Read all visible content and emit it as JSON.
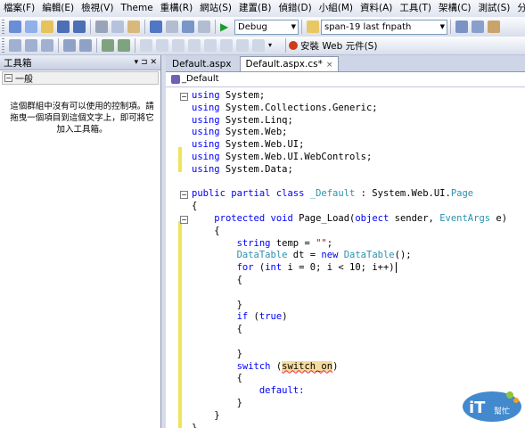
{
  "menu": [
    "檔案(F)",
    "編輯(E)",
    "檢視(V)",
    "Theme",
    "重構(R)",
    "網站(S)",
    "建置(B)",
    "偵錯(D)",
    "小組(M)",
    "資料(A)",
    "工具(T)",
    "架構(C)",
    "測試(S)",
    "分析(N)"
  ],
  "toolbar": {
    "config_combo": "Debug",
    "search_combo": "span-19 last fnpath",
    "install_web": "安裝 Web 元件(S)"
  },
  "toolbox": {
    "title": "工具箱",
    "pin": "▾ ⊐ ✕",
    "group": "一般",
    "group_toggle": "−",
    "empty_message": "這個群組中沒有可以使用的控制項。請拖曳一個項目到這個文字上，即可將它加入工具箱。"
  },
  "tabs": [
    "Default.aspx",
    "Default.aspx.cs*"
  ],
  "tab_close": "×",
  "breadcrumb": "_Default",
  "code_lines": [
    [
      {
        "t": "using",
        "c": "kw"
      },
      {
        "t": " System;"
      }
    ],
    [
      {
        "t": "using",
        "c": "kw"
      },
      {
        "t": " System.Collections.Generic;"
      }
    ],
    [
      {
        "t": "using",
        "c": "kw"
      },
      {
        "t": " System.Linq;"
      }
    ],
    [
      {
        "t": "using",
        "c": "kw"
      },
      {
        "t": " System.Web;"
      }
    ],
    [
      {
        "t": "using",
        "c": "kw"
      },
      {
        "t": " System.Web.UI;"
      }
    ],
    [
      {
        "t": "using",
        "c": "kw"
      },
      {
        "t": " System.Web.UI.WebControls;"
      }
    ],
    [
      {
        "t": "using",
        "c": "kw"
      },
      {
        "t": " System.Data;"
      }
    ],
    [
      {
        "t": ""
      }
    ],
    [
      {
        "t": "public partial class",
        "c": "kw"
      },
      {
        "t": " "
      },
      {
        "t": "_Default",
        "c": "ty"
      },
      {
        "t": " : System.Web.UI."
      },
      {
        "t": "Page",
        "c": "ty"
      }
    ],
    [
      {
        "t": "{"
      }
    ],
    [
      {
        "t": "    "
      },
      {
        "t": "protected void",
        "c": "kw"
      },
      {
        "t": " Page_Load("
      },
      {
        "t": "object",
        "c": "kw"
      },
      {
        "t": " sender, "
      },
      {
        "t": "EventArgs",
        "c": "ty"
      },
      {
        "t": " e)"
      }
    ],
    [
      {
        "t": "    {"
      }
    ],
    [
      {
        "t": "        "
      },
      {
        "t": "string",
        "c": "kw"
      },
      {
        "t": " temp = "
      },
      {
        "t": "\"\"",
        "c": "str"
      },
      {
        "t": ";"
      }
    ],
    [
      {
        "t": "        "
      },
      {
        "t": "DataTable",
        "c": "ty"
      },
      {
        "t": " dt = "
      },
      {
        "t": "new",
        "c": "kw"
      },
      {
        "t": " "
      },
      {
        "t": "DataTable",
        "c": "ty"
      },
      {
        "t": "();"
      }
    ],
    [
      {
        "t": "        "
      },
      {
        "t": "for",
        "c": "kw"
      },
      {
        "t": " ("
      },
      {
        "t": "int",
        "c": "kw"
      },
      {
        "t": " i = 0; i < 10; i++)"
      },
      {
        "t": "",
        "c": "cursor"
      }
    ],
    [
      {
        "t": "        {"
      }
    ],
    [
      {
        "t": ""
      }
    ],
    [
      {
        "t": "        }"
      }
    ],
    [
      {
        "t": "        "
      },
      {
        "t": "if",
        "c": "kw"
      },
      {
        "t": " ("
      },
      {
        "t": "true",
        "c": "kw"
      },
      {
        "t": ")"
      }
    ],
    [
      {
        "t": "        {"
      }
    ],
    [
      {
        "t": ""
      }
    ],
    [
      {
        "t": "        }"
      }
    ],
    [
      {
        "t": "        "
      },
      {
        "t": "switch",
        "c": "kw"
      },
      {
        "t": " ("
      },
      {
        "t": "switch_on",
        "c": "hl"
      },
      {
        "t": ")"
      }
    ],
    [
      {
        "t": "        {"
      }
    ],
    [
      {
        "t": "            "
      },
      {
        "t": "default:",
        "c": "kw"
      }
    ],
    [
      {
        "t": "        }"
      }
    ],
    [
      {
        "t": "    }"
      }
    ],
    [
      {
        "t": "}"
      }
    ]
  ],
  "logo": {
    "main": "iT",
    "sub": "幫忙"
  }
}
